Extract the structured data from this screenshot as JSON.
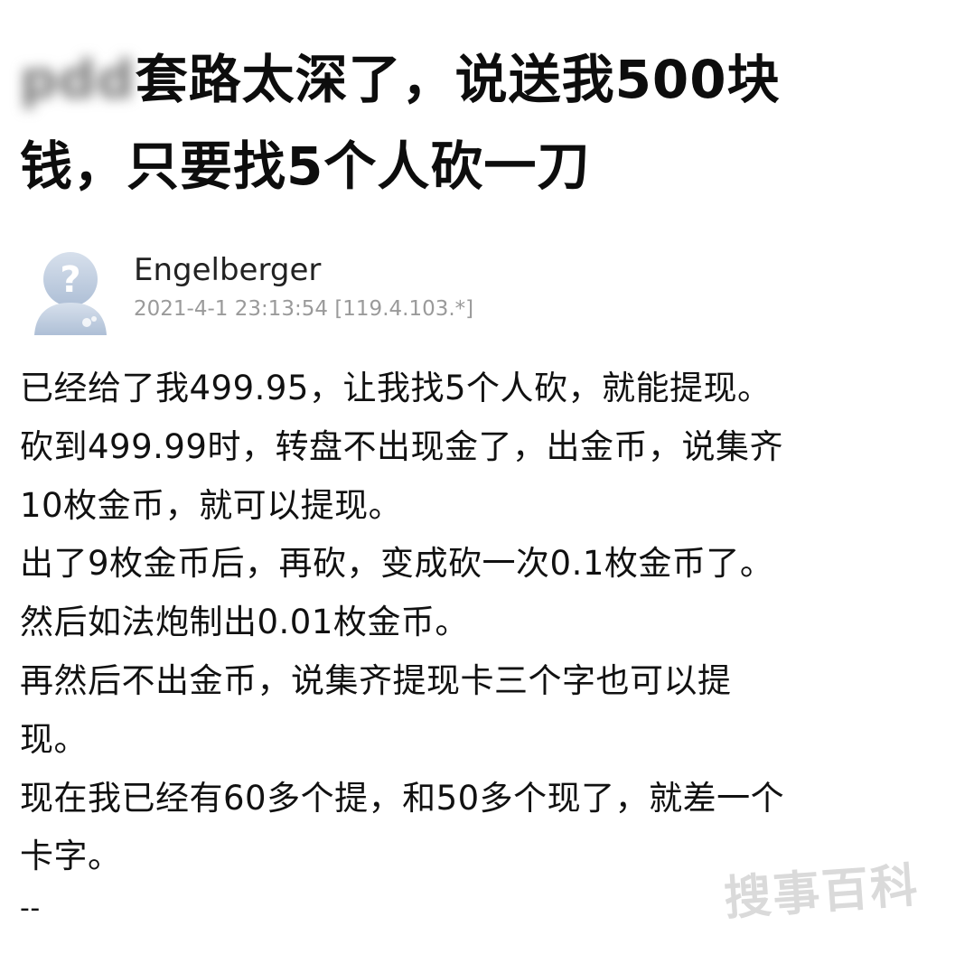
{
  "post": {
    "title_blurred_prefix": "pdd",
    "title_line1": "套路太深了，说送我500块",
    "title_line2": "钱，只要找5个人砍一刀"
  },
  "author": {
    "name": "Engelberger",
    "meta": "2021-4-1 23:13:54 [119.4.103.*]",
    "avatar_icon": "question-mark-user-icon",
    "avatar_color": "#c7d3e3"
  },
  "body": {
    "lines": [
      "已经给了我499.95，让我找5个人砍，就能提现。",
      "砍到499.99时，转盘不出现金了，出金币，说集齐",
      "10枚金币，就可以提现。",
      "出了9枚金币后，再砍，变成砍一次0.1枚金币了。",
      "然后如法炮制出0.01枚金币。",
      "再然后不出金币，说集齐提现卡三个字也可以提",
      "现。",
      "现在我已经有60多个提，和50多个现了，就差一个",
      "卡字。",
      "--"
    ]
  },
  "watermark": {
    "text": "搜事百科"
  }
}
